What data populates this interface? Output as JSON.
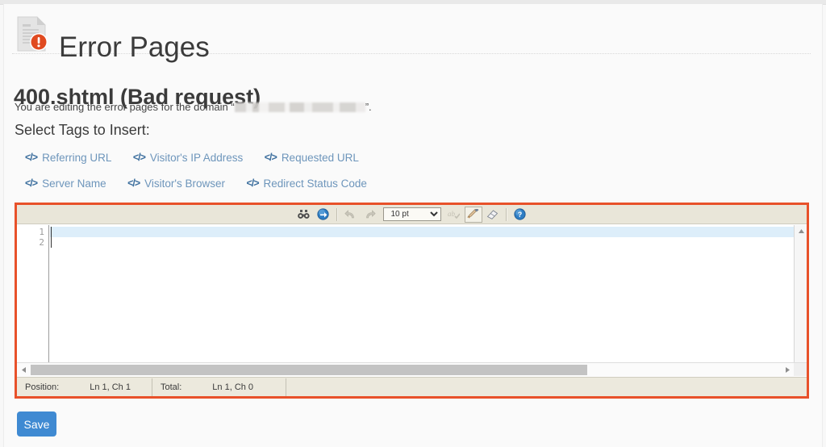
{
  "header": {
    "icon": "error-document-icon",
    "title": "Error Pages"
  },
  "page": {
    "file_title": "400.shtml (Bad request)",
    "edit_note_prefix": "You are editing the error pages for the domain “",
    "edit_note_suffix": "”.",
    "domain_redacted": true,
    "tags_label": "Select Tags to Insert:"
  },
  "tags": [
    {
      "icon": "code-icon",
      "label": "Referring URL"
    },
    {
      "icon": "code-icon",
      "label": "Visitor's IP Address"
    },
    {
      "icon": "code-icon",
      "label": "Requested URL"
    },
    {
      "icon": "code-icon",
      "label": "Server Name"
    },
    {
      "icon": "code-icon",
      "label": "Visitor's Browser"
    },
    {
      "icon": "code-icon",
      "label": "Redirect Status Code"
    }
  ],
  "editor": {
    "border_color": "#e8512a",
    "toolbar": {
      "find_icon": "binoculars-find-icon",
      "goto_icon": "goto-line-icon",
      "undo_icon": "undo-icon",
      "redo_icon": "redo-icon",
      "font_size_value": "10 pt",
      "spellcheck_icon": "spellcheck-icon",
      "brush_icon": "syntax-highlight-brush-icon",
      "eraser_icon": "eraser-icon",
      "help_icon": "help-icon"
    },
    "line_numbers": [
      "1",
      "2"
    ],
    "content": "",
    "active_line": 1
  },
  "statusbar": {
    "position_label": "Position:",
    "position_value": "Ln 1, Ch 1",
    "total_label": "Total:",
    "total_value": "Ln 1, Ch 0"
  },
  "actions": {
    "save_label": "Save"
  },
  "colors": {
    "accent_border": "#e8512a",
    "link": "#6d95bb",
    "button_primary": "#3f8ad2",
    "toolbar_bg": "#e9e6d9",
    "active_line_bg": "#ddeefa"
  }
}
